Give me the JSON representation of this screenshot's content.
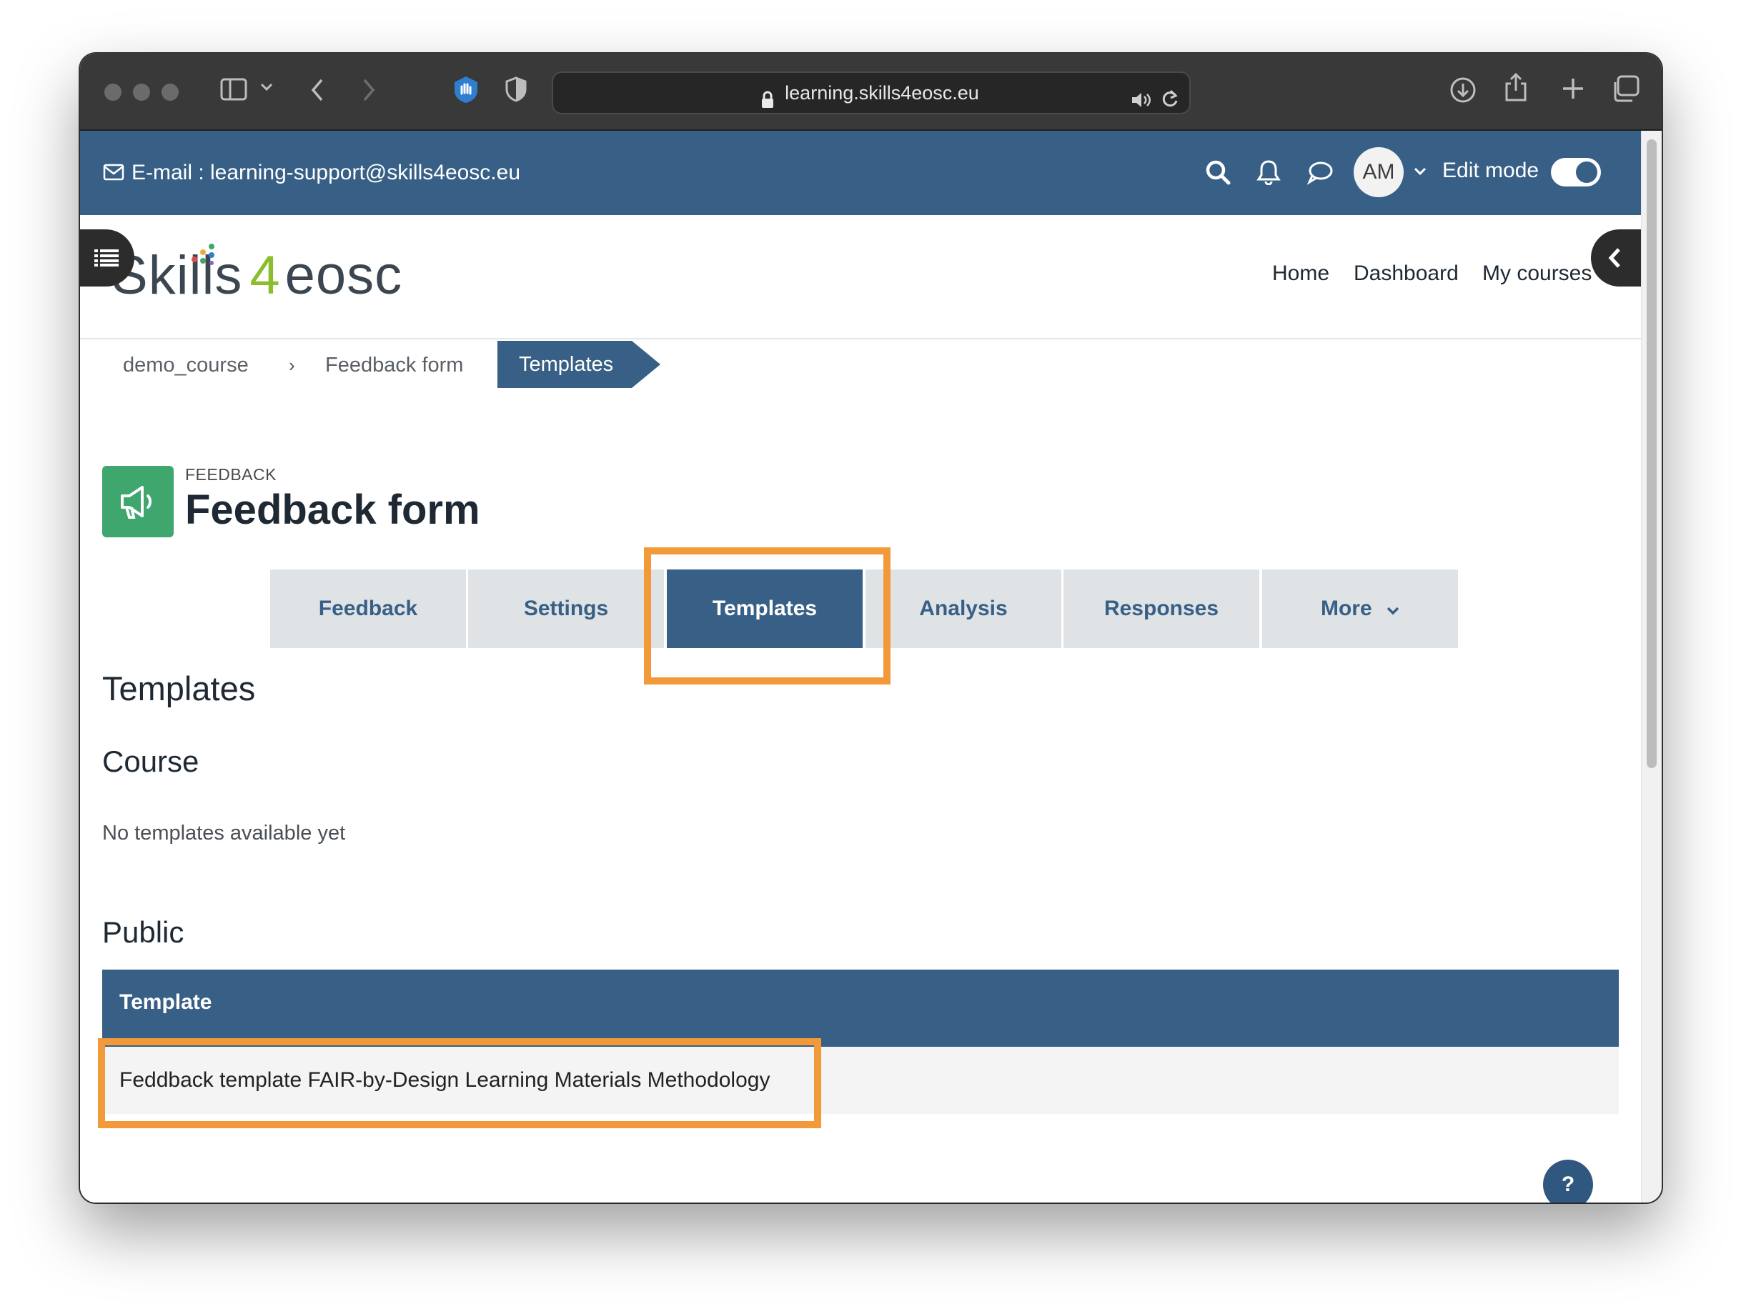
{
  "browser": {
    "url": "learning.skills4eosc.eu",
    "icons": [
      "sidebar-icon",
      "chevron-down-icon",
      "back-icon",
      "forward-icon",
      "privacy-hand-icon",
      "shield-icon",
      "lock-icon",
      "speaker-icon",
      "reload-icon",
      "download-icon",
      "share-icon",
      "plus-icon",
      "tabs-icon"
    ]
  },
  "topbar": {
    "email_label": "E-mail : learning-support@skills4eosc.eu",
    "avatar_initials": "AM",
    "edit_mode_label": "Edit mode",
    "edit_mode_on": true
  },
  "logo": {
    "part1": "Skills",
    "part2": "4",
    "part3": "eosc"
  },
  "nav": {
    "home": "Home",
    "dashboard": "Dashboard",
    "my_courses": "My courses"
  },
  "breadcrumb": {
    "items": [
      "demo_course",
      "Feedback form"
    ],
    "separator": "›",
    "active": "Templates"
  },
  "module": {
    "type": "FEEDBACK",
    "title": "Feedback form",
    "accent": "#3fa66e"
  },
  "tabs": [
    {
      "label": "Feedback"
    },
    {
      "label": "Settings"
    },
    {
      "label": "Templates",
      "active": true
    },
    {
      "label": "Analysis"
    },
    {
      "label": "Responses"
    },
    {
      "label": "More"
    }
  ],
  "content": {
    "heading": "Templates",
    "course_heading": "Course",
    "course_empty": "No templates available yet",
    "public_heading": "Public",
    "table": {
      "header": "Template",
      "rows": [
        "Feddback template FAIR-by-Design Learning Materials Methodology"
      ]
    }
  },
  "help_label": "?",
  "colors": {
    "brand": "#386086",
    "highlight": "#f2993a"
  }
}
